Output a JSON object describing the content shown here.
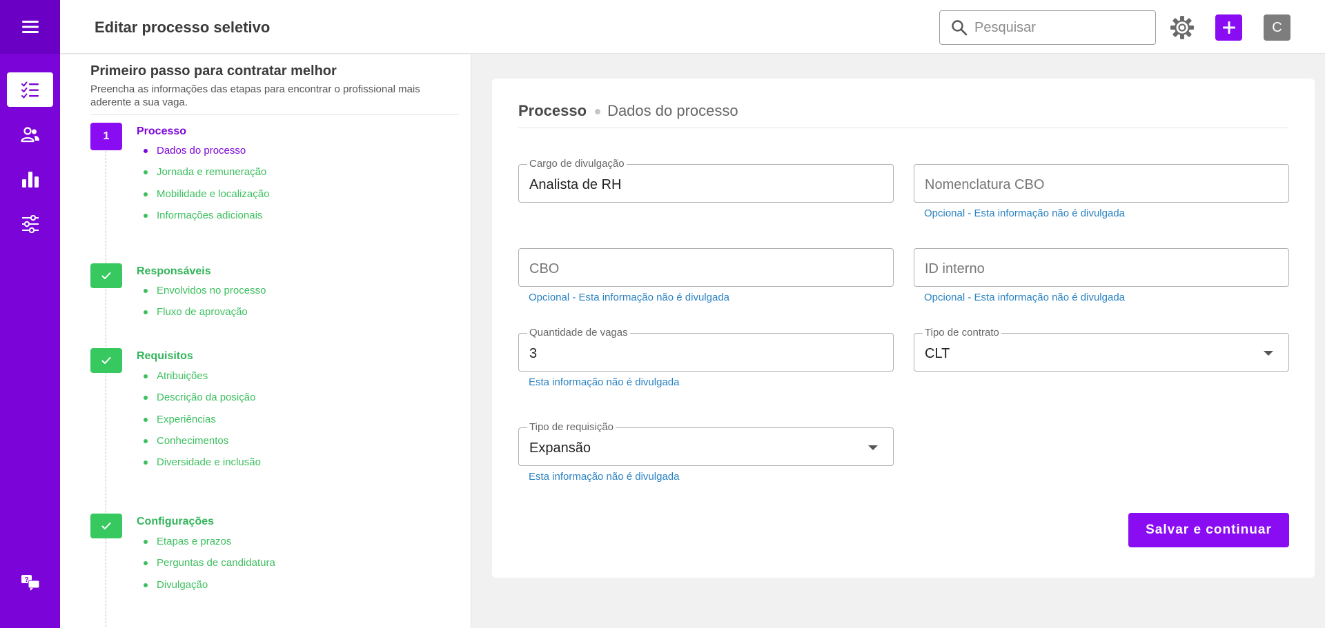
{
  "header": {
    "title": "Editar processo seletivo",
    "search_placeholder": "Pesquisar",
    "avatar_initial": "C"
  },
  "rail": {
    "items": [
      {
        "icon": "checklist-icon",
        "active": true
      },
      {
        "icon": "users-icon",
        "active": false
      },
      {
        "icon": "bar-chart-icon",
        "active": false
      },
      {
        "icon": "sliders-icon",
        "active": false
      }
    ],
    "bottom_icon": "help-chat-icon"
  },
  "steps_panel": {
    "title": "Primeiro passo para contratar melhor",
    "description": "Preencha as informações das etapas para encontrar o profissional mais aderente a sua vaga.",
    "steps": [
      {
        "number": "1",
        "status": "current",
        "title": "Processo",
        "substeps": [
          "Dados do processo",
          "Jornada e remuneração",
          "Mobilidade e localização",
          "Informações adicionais"
        ]
      },
      {
        "status": "done",
        "title": "Responsáveis",
        "substeps": [
          "Envolvidos no processo",
          "Fluxo de aprovação"
        ]
      },
      {
        "status": "done",
        "title": "Requisitos",
        "substeps": [
          "Atribuições",
          "Descrição da posição",
          "Experiências",
          "Conhecimentos",
          "Diversidade e inclusão"
        ]
      },
      {
        "status": "done",
        "title": "Configurações",
        "substeps": [
          "Etapas e prazos",
          "Perguntas de candidatura",
          "Divulgação"
        ]
      }
    ]
  },
  "form": {
    "breadcrumb_main": "Processo",
    "breadcrumb_sub": "Dados do processo",
    "fields": {
      "cargo": {
        "label": "Cargo de divulgação",
        "value": "Analista de RH"
      },
      "nomenclatura_cbo": {
        "placeholder": "Nomenclatura CBO",
        "helper": "Opcional - Esta informação não é divulgada"
      },
      "cbo": {
        "placeholder": "CBO",
        "helper": "Opcional - Esta informação não é divulgada"
      },
      "id_interno": {
        "placeholder": "ID interno",
        "helper": "Opcional - Esta informação não é divulgada"
      },
      "quantidade": {
        "label": "Quantidade de vagas",
        "value": "3",
        "helper": "Esta informação não é divulgada"
      },
      "tipo_contrato": {
        "label": "Tipo de contrato",
        "value": "CLT"
      },
      "tipo_requisicao": {
        "label": "Tipo de requisição",
        "value": "Expansão",
        "helper": "Esta informação não é divulgada"
      }
    },
    "save_label": "Salvar e continuar"
  },
  "colors": {
    "brand_purple": "#8a0cf2",
    "rail_purple": "#7b05d8",
    "success_green": "#37c85f",
    "helper_blue": "#2a82c2"
  }
}
